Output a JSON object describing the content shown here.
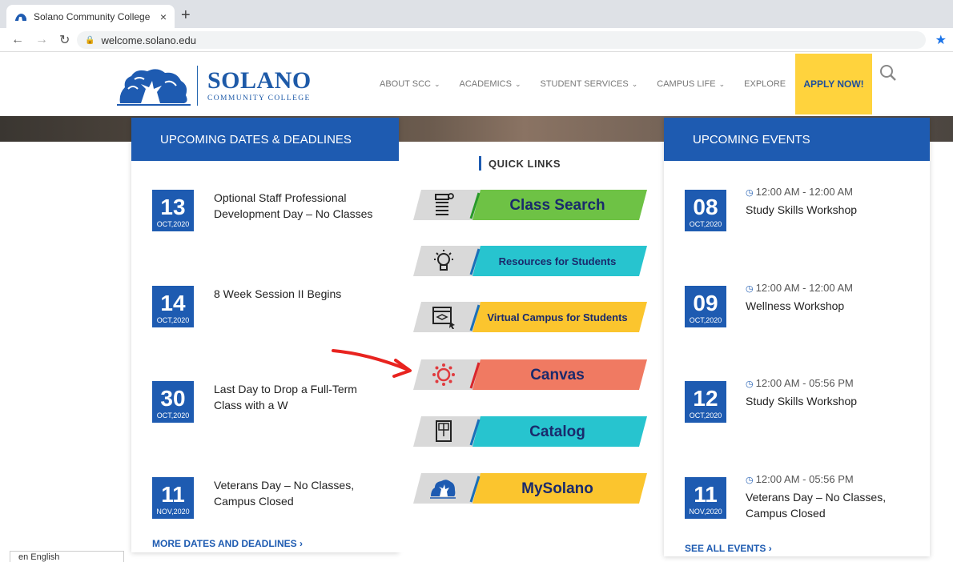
{
  "browser": {
    "tab_title": "Solano Community College",
    "tab_close": "×",
    "new_tab": "+",
    "url": "welcome.solano.edu"
  },
  "header": {
    "logo_name": "SOLANO",
    "logo_sub": "COMMUNITY COLLEGE",
    "nav": [
      "ABOUT SCC",
      "ACADEMICS",
      "STUDENT SERVICES",
      "CAMPUS LIFE",
      "EXPLORE"
    ],
    "apply_label": "APPLY NOW!"
  },
  "deadlines": {
    "heading": "UPCOMING DATES & DEADLINES",
    "items": [
      {
        "day": "13",
        "month": "OCT,2020",
        "text": "Optional Staff Professional Development Day – No Classes"
      },
      {
        "day": "14",
        "month": "OCT,2020",
        "text": "8 Week Session II Begins"
      },
      {
        "day": "30",
        "month": "OCT,2020",
        "text": "Last Day to Drop a Full-Term Class with a W"
      },
      {
        "day": "11",
        "month": "NOV,2020",
        "text": "Veterans Day – No Classes, Campus Closed"
      }
    ],
    "more_link": "MORE DATES AND DEADLINES ›"
  },
  "quick_links": {
    "heading": "QUICK LINKS",
    "items": [
      {
        "label": "Class Search",
        "color": "#6ec245",
        "icon": "list-icon"
      },
      {
        "label": "Resources for Students",
        "color": "#27c4cf",
        "icon": "lightbulb-icon"
      },
      {
        "label": "Virtual Campus for Students",
        "color": "#fbc52e",
        "icon": "virtual-campus-icon"
      },
      {
        "label": "Canvas",
        "color": "#f07a62",
        "icon": "canvas-icon"
      },
      {
        "label": "Catalog",
        "color": "#27c4cf",
        "icon": "book-icon"
      },
      {
        "label": "MySolano",
        "color": "#fbc52e",
        "icon": "solano-tree-icon"
      }
    ]
  },
  "events": {
    "heading": "UPCOMING EVENTS",
    "items": [
      {
        "day": "08",
        "month": "OCT,2020",
        "time": "12:00 AM - 12:00 AM",
        "title": "Study Skills Workshop"
      },
      {
        "day": "09",
        "month": "OCT,2020",
        "time": "12:00 AM - 12:00 AM",
        "title": "Wellness Workshop"
      },
      {
        "day": "12",
        "month": "OCT,2020",
        "time": "12:00 AM - 05:56 PM",
        "title": "Study Skills Workshop"
      },
      {
        "day": "11",
        "month": "NOV,2020",
        "time": "12:00 AM - 05:56 PM",
        "title": "Veterans Day – No Classes, Campus Closed"
      }
    ],
    "more_link": "SEE ALL EVENTS ›"
  },
  "language": {
    "label": "en English"
  },
  "colors": {
    "brand_blue": "#1e5bb1",
    "apply_yellow": "#ffd33d",
    "annotation_red": "#e8231f"
  }
}
